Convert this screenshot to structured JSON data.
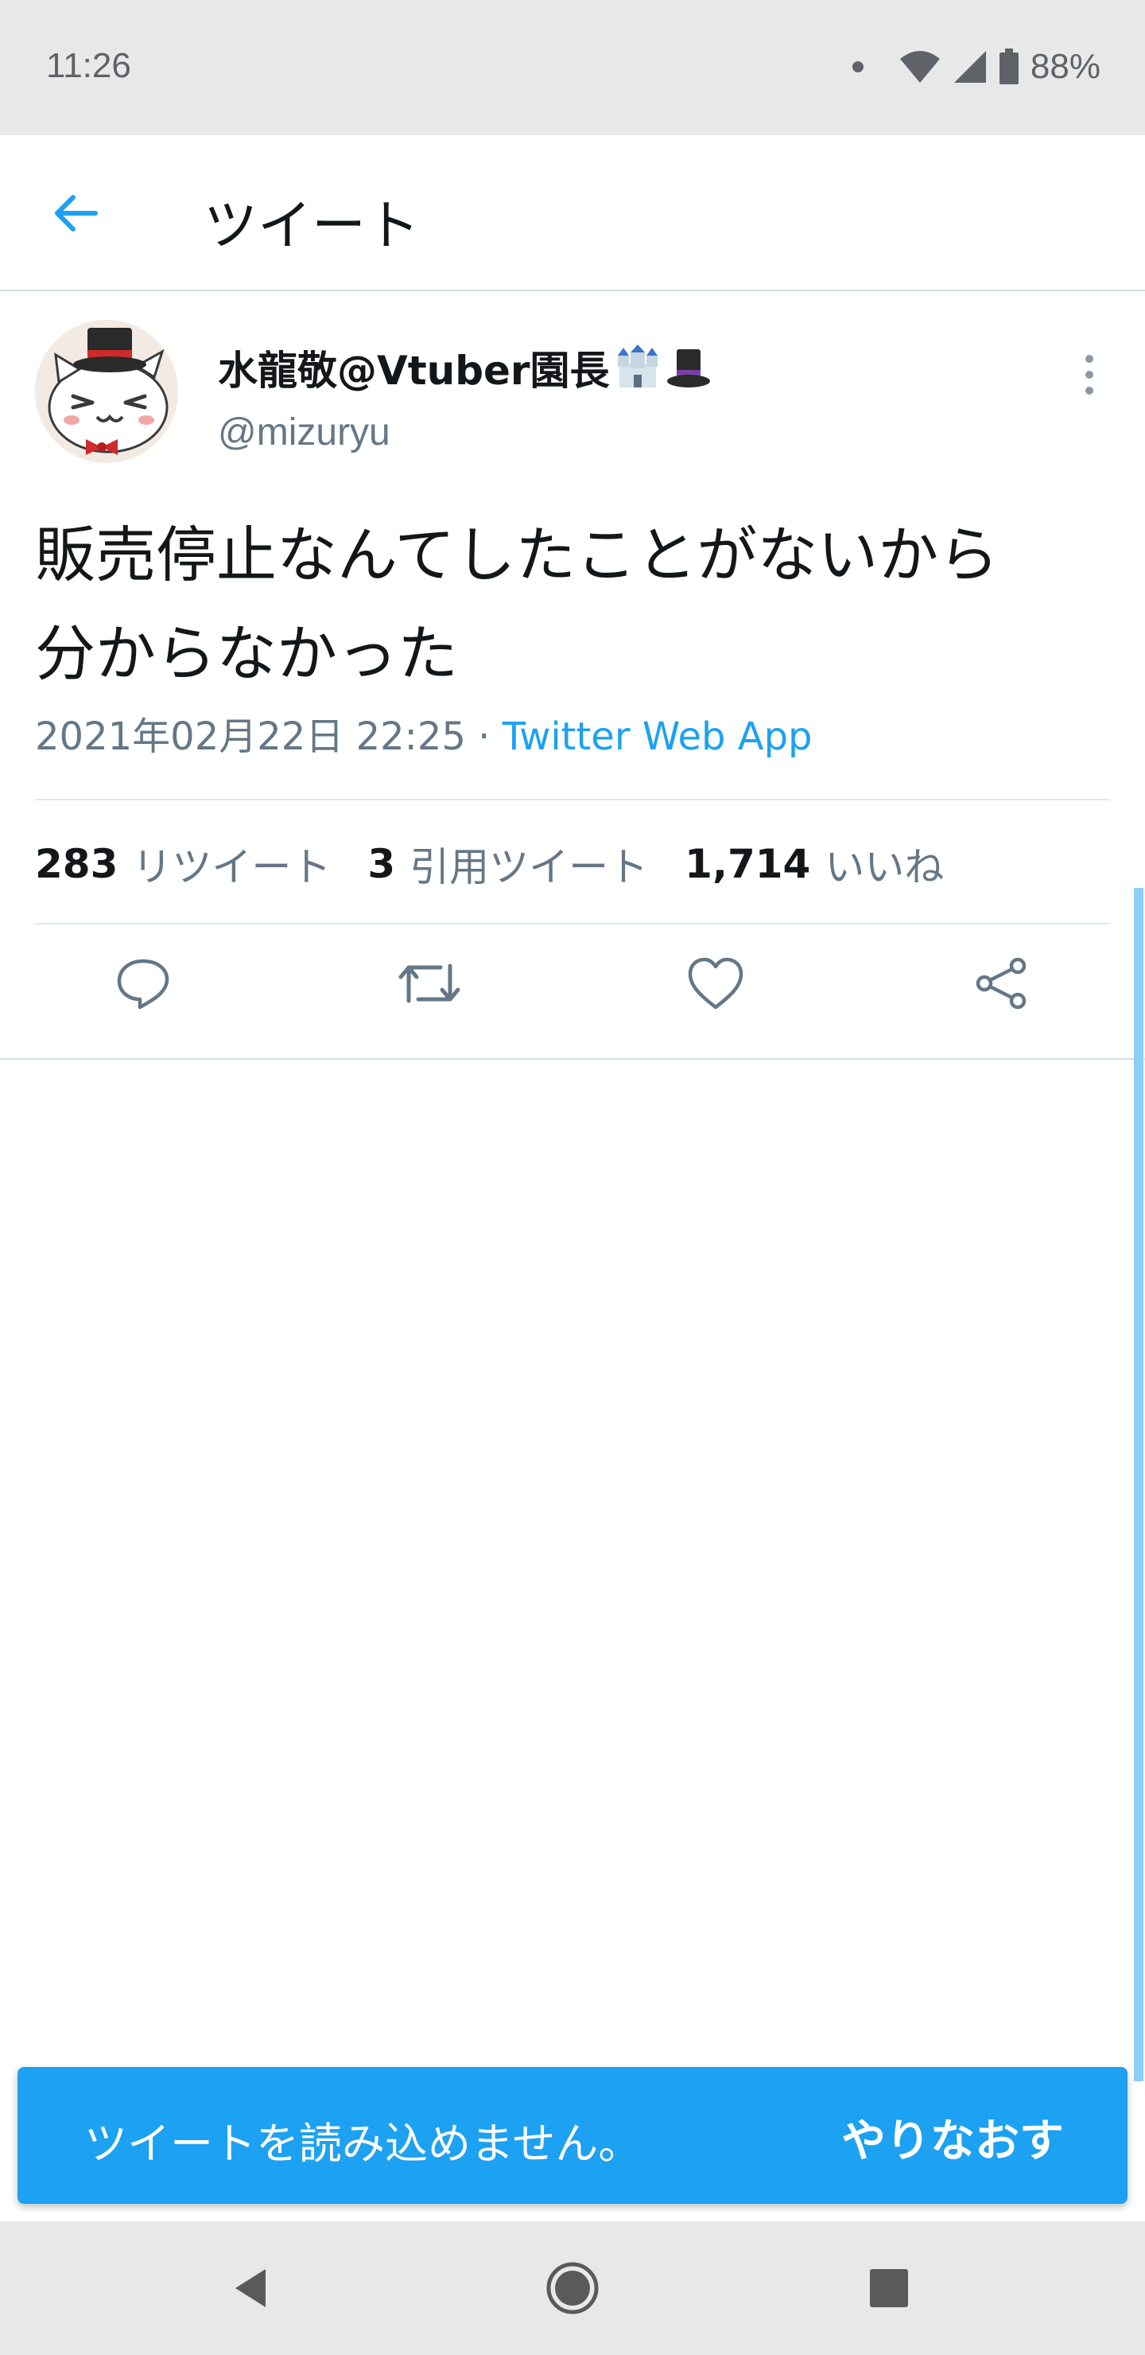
{
  "status_bar": {
    "time": "11:26",
    "battery": "88%"
  },
  "app_bar": {
    "title": "ツイート"
  },
  "tweet": {
    "display_name": "水龍敬@Vtuber園長",
    "name_emojis": [
      "castle-emoji",
      "top-hat-emoji"
    ],
    "handle": "@mizuryu",
    "text_line1": "販売停止なんてしたことがないから",
    "text_line2": "分からなかった",
    "timestamp": "2021年02月22日 22:25",
    "separator": " · ",
    "source": "Twitter Web App",
    "stats": {
      "retweets_count": "283",
      "retweets_label": "リツイート",
      "quotes_count": "3",
      "quotes_label": "引用ツイート",
      "likes_count": "1,714",
      "likes_label": "いいね"
    }
  },
  "snackbar": {
    "message": "ツイートを読み込めません。",
    "action": "やりなおす"
  },
  "colors": {
    "accent": "#1da1f2",
    "text_primary": "#14171a",
    "text_secondary": "#657786",
    "system_bar": "#e8e8e8"
  }
}
